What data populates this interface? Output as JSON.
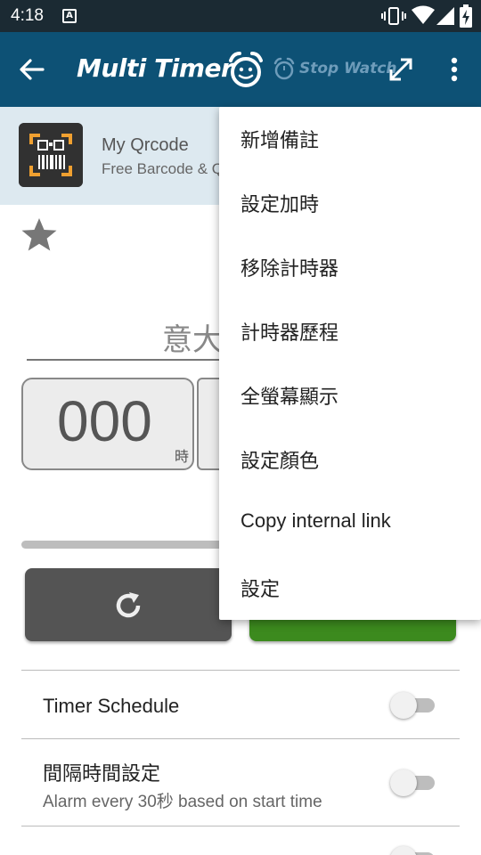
{
  "status_bar": {
    "time": "4:18",
    "notification_icon": "a-notification-icon",
    "icons": [
      "vibrate-icon",
      "wifi-icon",
      "signal-icon",
      "battery-charging-icon"
    ]
  },
  "app_bar": {
    "title": "Multi Timer",
    "stopwatch_label": "Stop Watch",
    "brand_color": "#0d5175"
  },
  "ad": {
    "app_name": "My Qrcode",
    "description": "Free Barcode & Q"
  },
  "timer": {
    "name": "意大",
    "hours": "000",
    "hours_unit": "時",
    "start_button_color": "#3c8a1e",
    "reset_button_color": "#545454"
  },
  "settings": {
    "schedule": {
      "title": "Timer Schedule",
      "enabled": false
    },
    "interval": {
      "title": "間隔時間設定",
      "subtitle": "Alarm every 30秒 based on start time",
      "enabled": false
    }
  },
  "menu": {
    "items": [
      "新增備註",
      "設定加時",
      "移除計時器",
      "計時器歷程",
      "全螢幕顯示",
      "設定顏色",
      "Copy internal link",
      "設定"
    ]
  }
}
